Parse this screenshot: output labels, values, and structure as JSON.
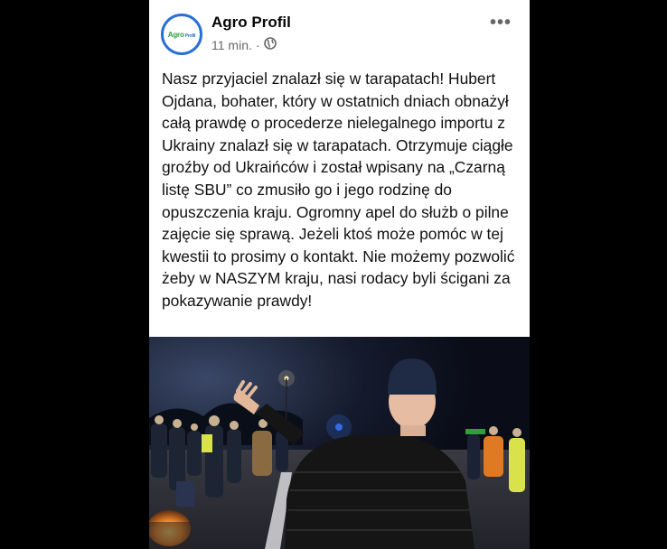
{
  "post": {
    "page_name": "Agro Profil",
    "logo_text": "Agro",
    "logo_text_small": "Profil",
    "time": "11 min.",
    "separator": "·",
    "audience_icon": "globe-icon",
    "more_icon": "more-options-icon",
    "more_label": "•••",
    "text": "Nasz przyjaciel znalazł się w tarapatach! Hubert Ojdana, bohater, który w ostatnich dniach obnażył całą prawdę o procederze nielegalnego importu z Ukrainy znalazł się w tarapatach. Otrzymuje ciągłe groźby od Ukraińców i został wpisany na „Czarną listę SBU” co zmusiło go i jego rodzinę do opuszczenia kraju. Ogromny apel do służb o pilne zajęcie się sprawą. Jeżeli ktoś może pomóc w tej kwestii to prosimy o kontakt. Nie możemy pozwolić żeby w NASZYM kraju, nasi rodacy byli ścigani za pokazywanie prawdy!"
  },
  "colors": {
    "brand_blue": "#2a6fd6",
    "brand_green": "#2f9e3f",
    "meta_gray": "#65676b",
    "page_background": "#000000"
  }
}
